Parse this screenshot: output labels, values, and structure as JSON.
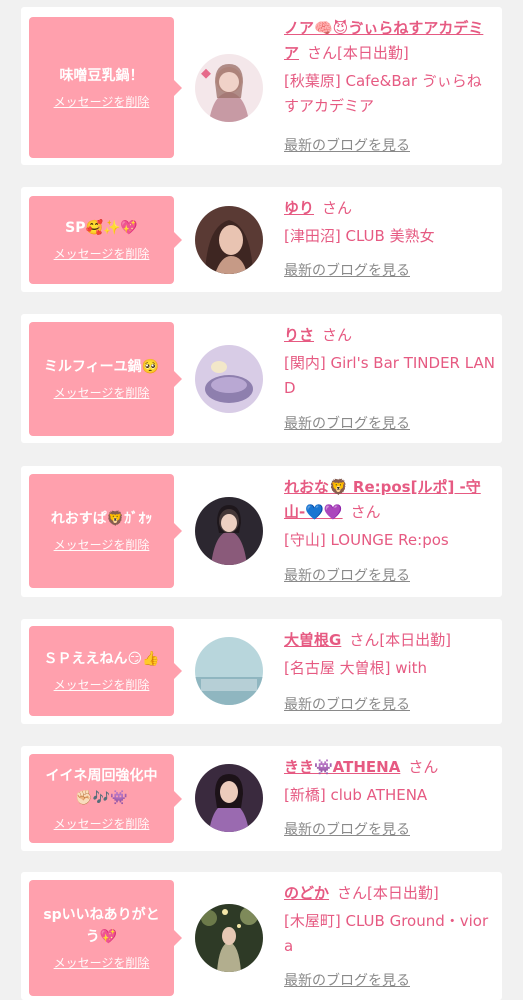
{
  "delete_label": "メッセージを削除",
  "blog_label": "最新のブログを見る",
  "colors": {
    "bubble": "#ffa0ad",
    "name": "#e65a82",
    "link_gray": "#8a8a8a",
    "background": "#f1f1f1"
  },
  "items": [
    {
      "message": "味噌豆乳鍋！",
      "name": "ノア🧠😈ゔぃらねすアカデミア",
      "suffix": "さん",
      "status": "[本日出勤]",
      "shop": "[秋葉原] Cafe&Bar ゔぃらねすアカデミア",
      "avatar_colors": [
        "#f4e7ea",
        "#c79aa4"
      ]
    },
    {
      "message": "SP🥰✨💖",
      "name": "ゆり",
      "suffix": "さん",
      "status": "",
      "shop": "[津田沼] CLUB 美熟女",
      "avatar_colors": [
        "#5a3a34",
        "#c69a86"
      ]
    },
    {
      "message": "ミルフィーユ鍋🥺",
      "name": "りさ",
      "suffix": "さん",
      "status": "",
      "shop": "[関内] Girl's Bar TINDER LAND",
      "avatar_colors": [
        "#d8cce6",
        "#8e7fae"
      ]
    },
    {
      "message": "れおすぱ🦁ｶﾞｵｯ",
      "name": "れおな🦁 Re:pos[ルポ] -守山-💙💜",
      "suffix": "さん",
      "status": "",
      "shop": "[守山] LOUNGE Re:pos",
      "avatar_colors": [
        "#2c2730",
        "#8a5a7a"
      ]
    },
    {
      "message": "ＳＰええねん😏👍",
      "name": "大曽根G",
      "suffix": "さん",
      "status": "[本日出勤]",
      "shop": "[名古屋 大曽根] with",
      "avatar_colors": [
        "#b8d6dc",
        "#8fb6c0"
      ]
    },
    {
      "message": "イイネ周回強化中✊🏻🎶👾",
      "name": "きき👾ATHENA",
      "suffix": "さん",
      "status": "",
      "shop": "[新橋] club ATHENA",
      "avatar_colors": [
        "#3a2a3e",
        "#9a6ab0"
      ]
    },
    {
      "message": "spいいねありがとう💖",
      "name": "のどか",
      "suffix": "さん",
      "status": "[本日出勤]",
      "shop": "[木屋町] CLUB Ground・viora",
      "avatar_colors": [
        "#2e3a26",
        "#b2ae8e"
      ]
    }
  ]
}
